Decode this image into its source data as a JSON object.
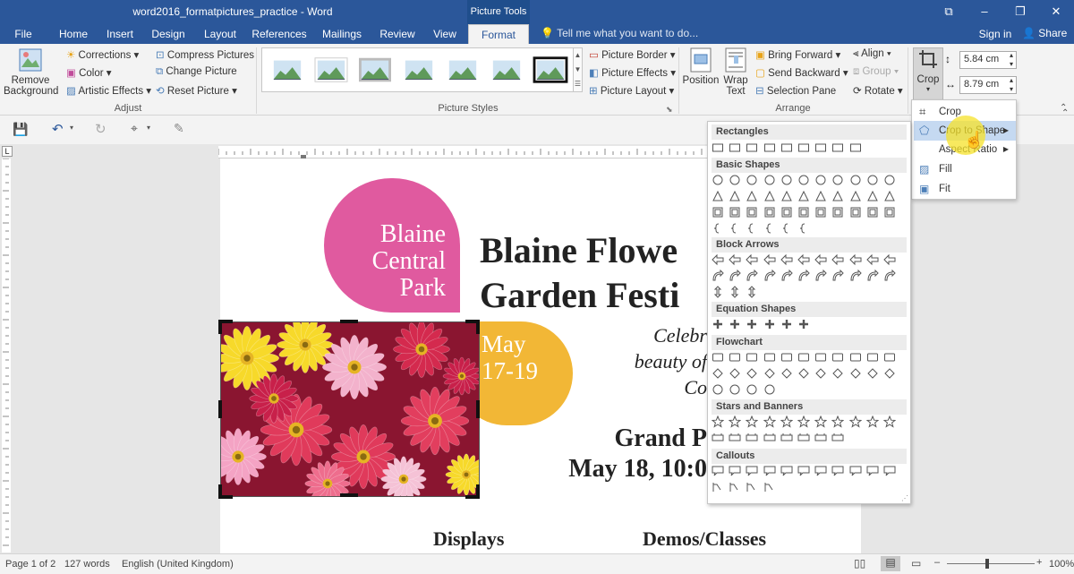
{
  "window": {
    "title": "word2016_formatpictures_practice - Word",
    "context_tab": "Picture Tools",
    "minimize": "–",
    "restore": "❐",
    "close": "✕",
    "ribbon_options": "⧉"
  },
  "tabs": {
    "file": "File",
    "home": "Home",
    "insert": "Insert",
    "design": "Design",
    "layout": "Layout",
    "references": "References",
    "mailings": "Mailings",
    "review": "Review",
    "view": "View",
    "format": "Format",
    "tellme": "Tell me what you want to do...",
    "signin": "Sign in",
    "share": "Share"
  },
  "ribbon": {
    "adjust": {
      "remove_bg_line1": "Remove",
      "remove_bg_line2": "Background",
      "corrections": "Corrections",
      "color": "Color",
      "artistic": "Artistic Effects",
      "compress": "Compress Pictures",
      "change": "Change Picture",
      "reset": "Reset Picture",
      "group": "Adjust"
    },
    "styles": {
      "group": "Picture Styles",
      "border": "Picture Border",
      "effects": "Picture Effects",
      "layout": "Picture Layout"
    },
    "arrange": {
      "position": "Position",
      "wrap_line1": "Wrap",
      "wrap_line2": "Text",
      "bring_forward": "Bring Forward",
      "send_backward": "Send Backward",
      "selection_pane": "Selection Pane",
      "align": "Align",
      "group_btn": "Group",
      "rotate": "Rotate",
      "group": "Arrange"
    },
    "size": {
      "crop": "Crop",
      "height": "5.84 cm",
      "width": "8.79 cm"
    }
  },
  "crop_menu": {
    "crop": "Crop",
    "crop_to_shape": "Crop to Shape",
    "aspect_ratio": "Aspect Ratio",
    "fill": "Fill",
    "fit": "Fit"
  },
  "shapes": {
    "rectangles": "Rectangles",
    "basic": "Basic Shapes",
    "block_arrows": "Block Arrows",
    "equation": "Equation Shapes",
    "flowchart": "Flowchart",
    "stars": "Stars and Banners",
    "callouts": "Callouts"
  },
  "document": {
    "circle1_line1": "Blaine",
    "circle1_line2": "Central",
    "circle1_line3": "Park",
    "circle2_line1": "May",
    "circle2_line2": "17-19",
    "heading_line1": "Blaine Flowe",
    "heading_line2": "Garden Festi",
    "italic_line1": "Celebr",
    "italic_line2": "beauty of",
    "italic_line3": "Co",
    "grand_line1": "Grand P",
    "grand_line2": "May 18, 10:0",
    "col1": "Displays",
    "col2": "Demos/Classes"
  },
  "status": {
    "page": "Page 1 of 2",
    "words": "127 words",
    "language": "English (United Kingdom)",
    "zoom": "100%"
  },
  "colors": {
    "brand": "#2b579a",
    "pink": "#e05a9f",
    "gold": "#f2b736",
    "cursor_highlight": "#f5e12a"
  }
}
